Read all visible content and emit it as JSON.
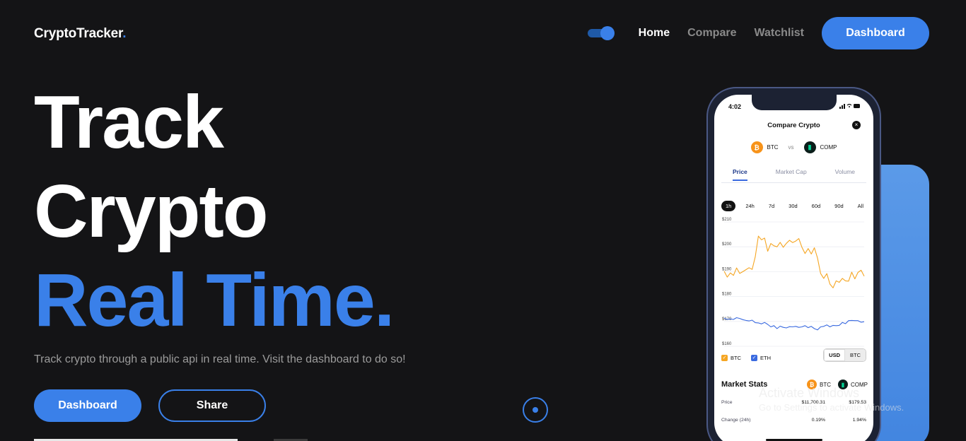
{
  "brand": {
    "name": "CryptoTracker",
    "dot": "."
  },
  "nav": {
    "links": [
      "Home",
      "Compare",
      "Watchlist"
    ],
    "cta": "Dashboard"
  },
  "hero": {
    "line1": "Track",
    "line2": "Crypto",
    "line3": "Real Time.",
    "subtitle": "Track crypto through a public api in real time. Visit the dashboard to do so!",
    "primary_button": "Dashboard",
    "secondary_button": "Share"
  },
  "phone": {
    "time": "4:02",
    "title": "Compare Crypto",
    "coin_a": "BTC",
    "vs": "vs",
    "coin_b": "COMP",
    "tabs": [
      "Price",
      "Market Cap",
      "Volume"
    ],
    "ranges": [
      "1h",
      "24h",
      "7d",
      "30d",
      "60d",
      "90d",
      "All"
    ],
    "chart_data": {
      "type": "line",
      "y_ticks": [
        "$210",
        "$200",
        "$190",
        "$180",
        "$170",
        "$160"
      ],
      "ylim": [
        160,
        210
      ],
      "series": [
        {
          "name": "BTC",
          "color": "#f5a623",
          "values": [
            190.2,
            187.8,
            189.5,
            188.5,
            191.5,
            189.3,
            190.0,
            190.8,
            191.6,
            190.9,
            196.0,
            204.3,
            202.8,
            203.5,
            198.2,
            201.3,
            200.4,
            200.0,
            201.8,
            199.8,
            201.4,
            202.6,
            201.7,
            202.3,
            203.3,
            199.8,
            197.3,
            199.3,
            197.1,
            199.6,
            195.5,
            189.3,
            187.3,
            189.2,
            185.0,
            183.5,
            186.3,
            185.7,
            187.3,
            186.3,
            186.2,
            189.8,
            187.1,
            189.7,
            190.6,
            188.2
          ]
        },
        {
          "name": "ETH",
          "color": "#3a6ae0",
          "values": [
            171.3,
            170.8,
            171.0,
            170.8,
            171.5,
            171.2,
            170.7,
            170.4,
            170.2,
            170.5,
            169.5,
            169.4,
            169.0,
            169.6,
            168.8,
            167.8,
            168.3,
            167.1,
            168.1,
            167.6,
            167.4,
            167.9,
            167.8,
            168.0,
            167.6,
            167.8,
            168.3,
            167.5,
            168.0,
            167.1,
            166.6,
            167.8,
            168.0,
            168.6,
            167.8,
            168.4,
            168.3,
            168.4,
            169.6,
            169.1,
            170.3,
            170.4,
            170.3,
            170.3,
            169.7,
            169.9
          ]
        }
      ]
    },
    "legend": [
      "BTC",
      "ETH"
    ],
    "currency": [
      "USD",
      "BTC"
    ],
    "stats_title": "Market Stats",
    "stats": [
      {
        "label": "Price",
        "a": "$11,700.31",
        "b": "$179.53"
      },
      {
        "label": "Change (24h)",
        "a": "0.19%",
        "b": "1.94%"
      }
    ]
  },
  "watermark": {
    "title": "Activate Windows",
    "text": "Go to Settings to activate Windows."
  },
  "colors": {
    "accent": "#3a80e9",
    "background": "#141416",
    "muted": "#9b9b9b"
  }
}
